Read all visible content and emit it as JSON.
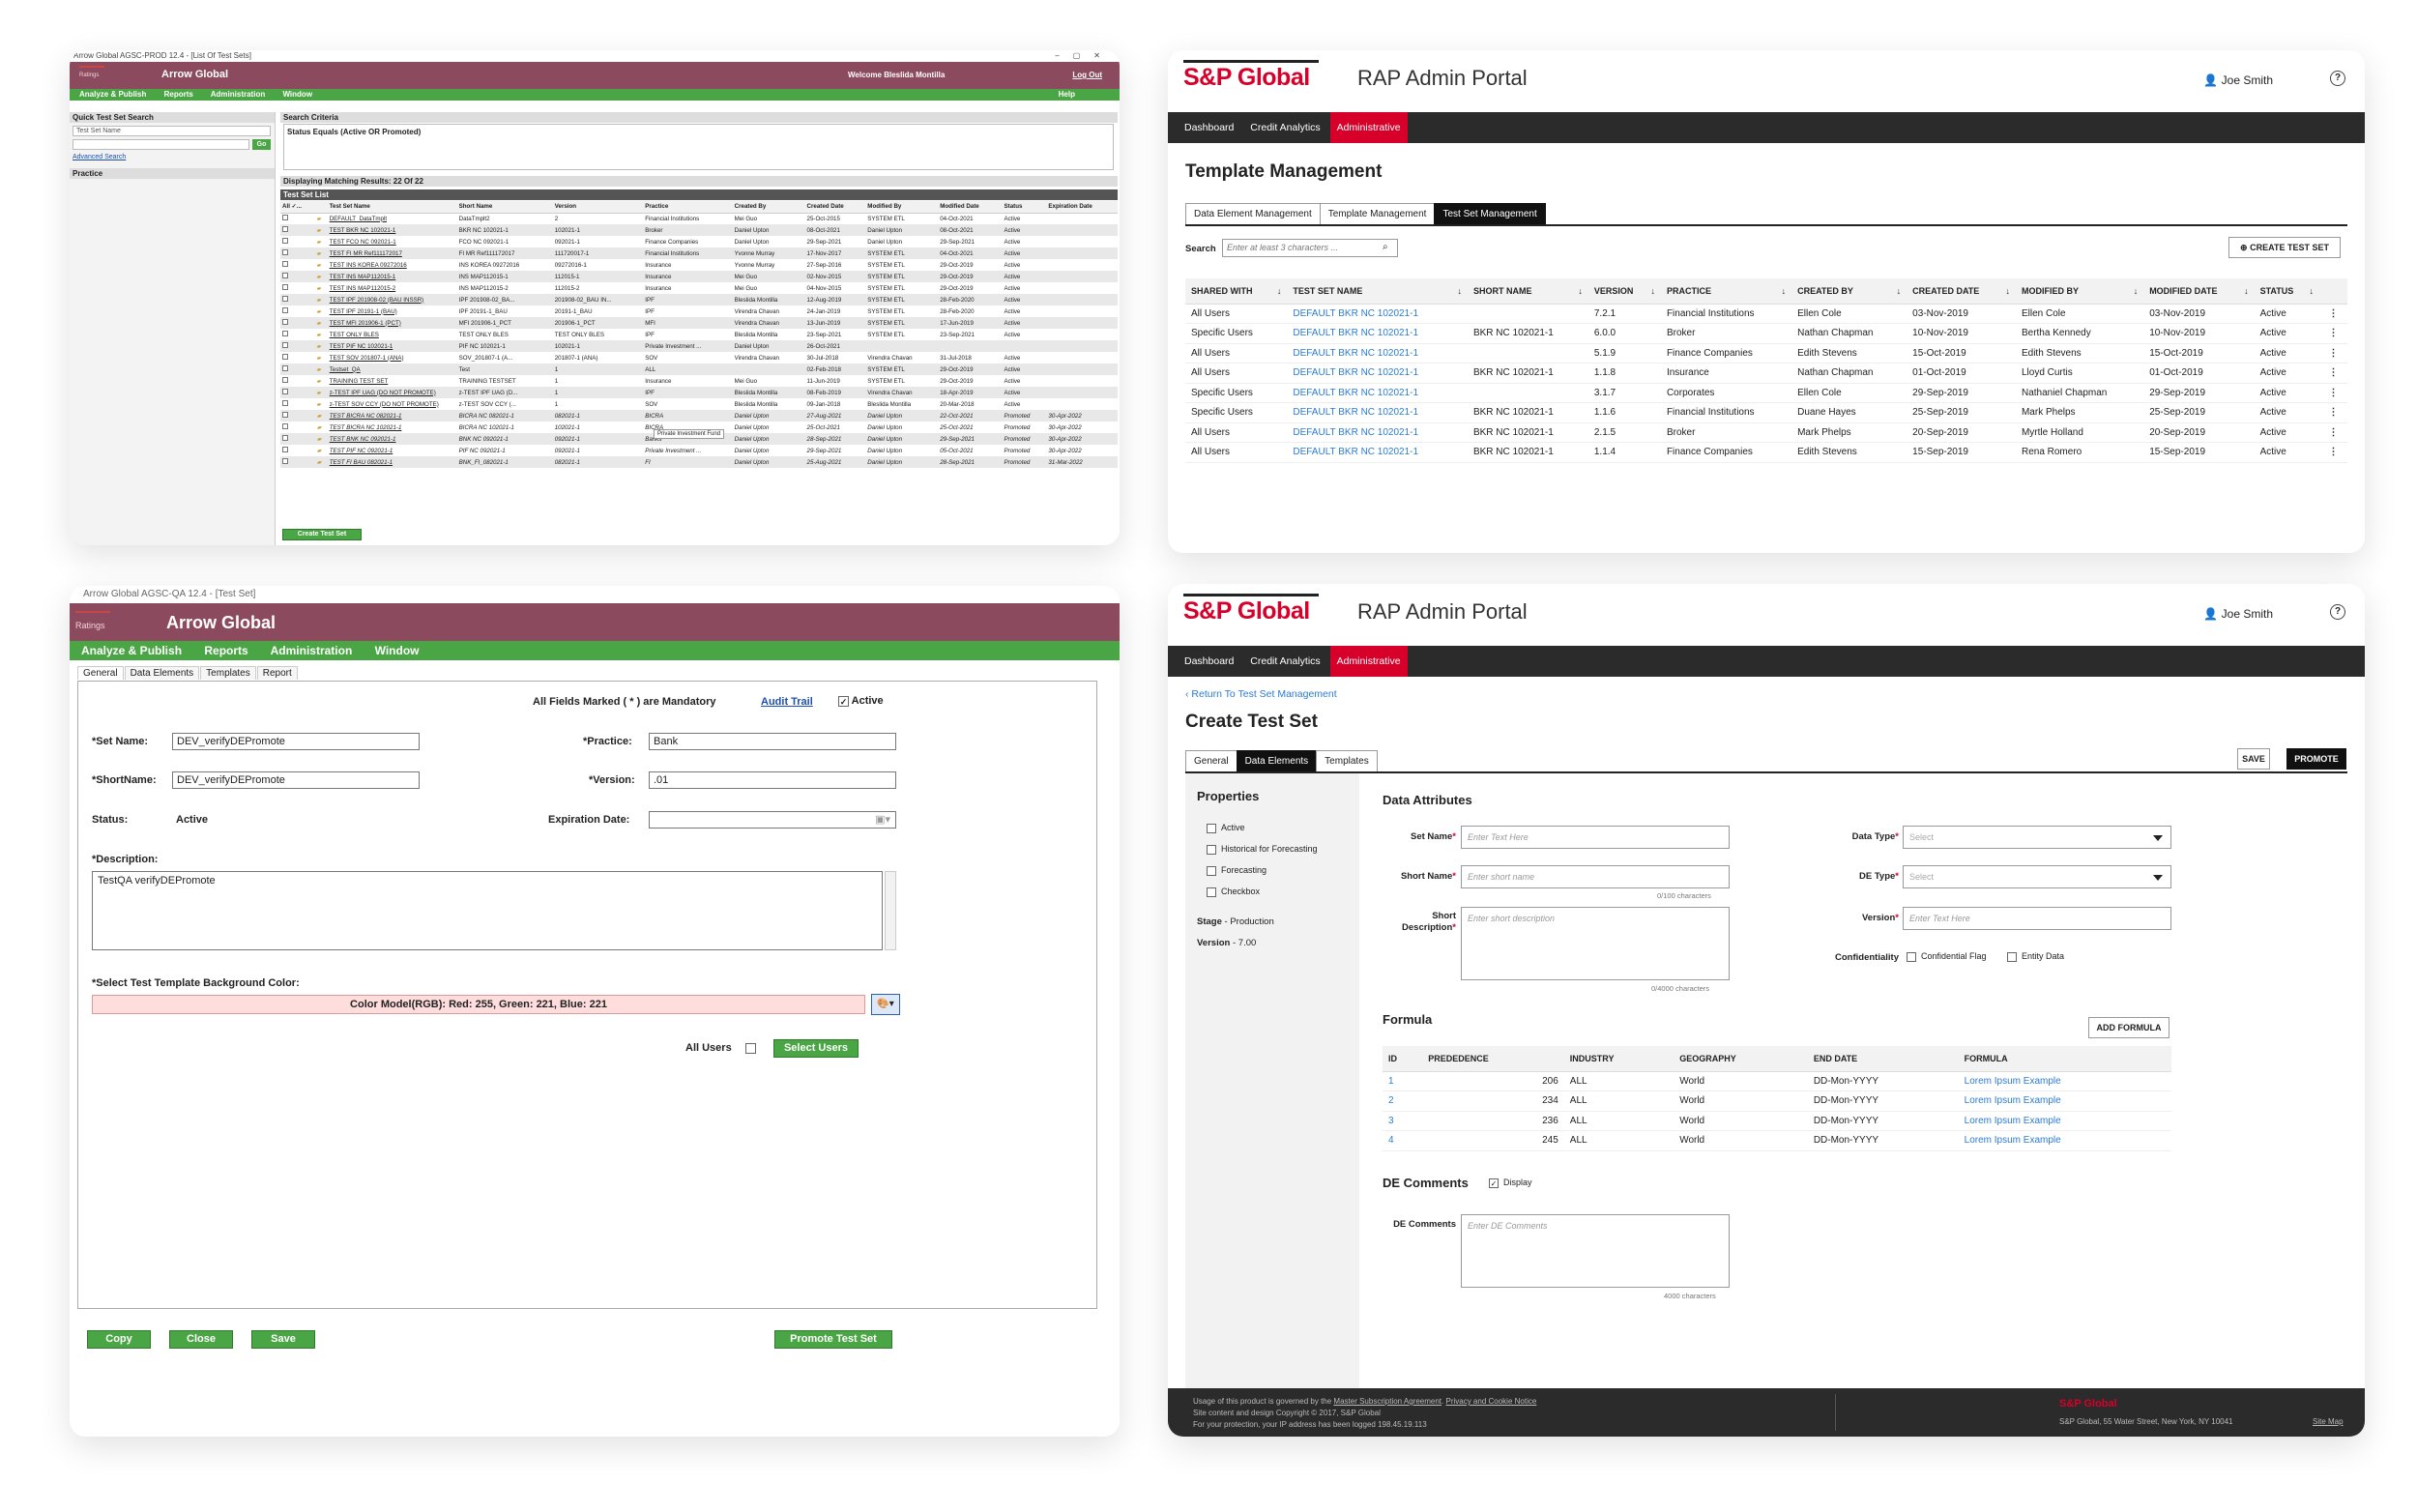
{
  "legacy_list": {
    "window_title": "Arrow Global AGSC-PROD 12.4 - [List Of Test Sets]",
    "logo_text": "Ratings",
    "app_name": "Arrow Global",
    "welcome": "Welcome  Bleslida Montilla",
    "logout": "Log Out",
    "nav": [
      "Analyze & Publish",
      "Reports",
      "Administration",
      "Window"
    ],
    "help": "Help",
    "quick_search_title": "Quick Test Set Search",
    "quick_search_select": "Test Set Name",
    "go": "Go",
    "advanced_search": "Advanced Search",
    "practice_title": "Practice",
    "search_criteria_title": "Search Criteria",
    "search_criteria_value": "Status Equals (Active OR Promoted)",
    "results": "Displaying Matching Results: 22 Of 22",
    "list_title": "Test Set List",
    "columns": [
      "All ✓...",
      "",
      "Test Set Name",
      "Short Name",
      "Version",
      "Practice",
      "Created By",
      "Created Date",
      "Modified By",
      "Modified Date",
      "Status",
      "Expiration Date"
    ],
    "rows": [
      [
        "DEFAULT_DataTmplt",
        "DataTmplt2",
        "2",
        "Financial Institutions",
        "Mei Guo",
        "25-Oct-2015",
        "SYSTEM ETL",
        "04-Oct-2021",
        "Active",
        ""
      ],
      [
        "TEST BKR NC 102021-1",
        "BKR NC 102021-1",
        "102021-1",
        "Broker",
        "Daniel Upton",
        "08-Oct-2021",
        "Daniel Upton",
        "08-Oct-2021",
        "Active",
        ""
      ],
      [
        "TEST FCO NC 092021-1",
        "FCO NC 092021-1",
        "092021-1",
        "Finance Companies",
        "Daniel Upton",
        "29-Sep-2021",
        "Daniel Upton",
        "29-Sep-2021",
        "Active",
        ""
      ],
      [
        "TEST FI MR Ref111172017",
        "FI MR Ref111172017",
        "111720017-1",
        "Financial Institutions",
        "Yvonne Murray",
        "17-Nov-2017",
        "SYSTEM ETL",
        "04-Oct-2021",
        "Active",
        ""
      ],
      [
        "TEST INS KOREA 09272016",
        "INS KOREA 09272016",
        "09272016-1",
        "Insurance",
        "Yvonne Murray",
        "27-Sep-2016",
        "SYSTEM ETL",
        "29-Oct-2019",
        "Active",
        ""
      ],
      [
        "TEST INS MAP112015-1",
        "INS MAP112015-1",
        "112015-1",
        "Insurance",
        "Mei Guo",
        "02-Nov-2015",
        "SYSTEM ETL",
        "29-Oct-2019",
        "Active",
        ""
      ],
      [
        "TEST INS MAP112015-2",
        "INS MAP112015-2",
        "112015-2",
        "Insurance",
        "Mei Guo",
        "04-Nov-2015",
        "SYSTEM ETL",
        "29-Oct-2019",
        "Active",
        ""
      ],
      [
        "TEST IPF 201908-02 (BAU INSSR)",
        "IPF 201908-02_BA...",
        "201908-02_BAU IN...",
        "IPF",
        "Bleslida Montilla",
        "12-Aug-2019",
        "SYSTEM ETL",
        "28-Feb-2020",
        "Active",
        ""
      ],
      [
        "TEST IPF 20191-1 (BAU)",
        "IPF 20191-1_BAU",
        "20191-1_BAU",
        "IPF",
        "Virendra Chavan",
        "24-Jan-2019",
        "SYSTEM ETL",
        "28-Feb-2020",
        "Active",
        ""
      ],
      [
        "TEST MFI 201906-1 (PCT)",
        "MFI 201906-1_PCT",
        "201906-1_PCT",
        "MFI",
        "Virendra Chavan",
        "13-Jun-2019",
        "SYSTEM ETL",
        "17-Jun-2019",
        "Active",
        ""
      ],
      [
        "TEST ONLY BLES",
        "TEST ONLY BLES",
        "TEST ONLY BLES",
        "IPF",
        "Bleslida Montilla",
        "23-Sep-2021",
        "SYSTEM ETL",
        "23-Sep-2021",
        "Active",
        ""
      ],
      [
        "TEST PIF NC 102021-1",
        "PIF NC 102021-1",
        "102021-1",
        "Private Investment ...",
        "Daniel Upton",
        "26-Oct-2021",
        "",
        "",
        "",
        ""
      ],
      [
        "TEST SOV 201807-1 (ANA)",
        "SOV_201807-1 (A...",
        "201807-1 (ANA)",
        "SOV",
        "Virendra Chavan",
        "30-Jul-2018",
        "Virendra Chavan",
        "31-Jul-2018",
        "Active",
        ""
      ],
      [
        "Testset_QA",
        "Test",
        "1",
        "ALL",
        "",
        "02-Feb-2018",
        "SYSTEM ETL",
        "29-Oct-2019",
        "Active",
        ""
      ],
      [
        "TRAINING TEST SET",
        "TRAINING TESTSET",
        "1",
        "Insurance",
        "Mei Guo",
        "11-Jun-2019",
        "SYSTEM ETL",
        "29-Oct-2019",
        "Active",
        ""
      ],
      [
        "z-TEST IPF UAG (DO NOT PROMOTE)",
        "z-TEST IPF UAG (D...",
        "1",
        "IPF",
        "Bleslida Montilla",
        "08-Feb-2019",
        "Virendra Chavan",
        "18-Apr-2019",
        "Active",
        ""
      ],
      [
        "z-TEST SOV CCY (DO NOT PROMOTE)",
        "z-TEST SOV CCY (...",
        "1",
        "SOV",
        "Bleslida Montilla",
        "09-Jan-2018",
        "Bleslida Montilla",
        "20-Mar-2018",
        "Active",
        ""
      ],
      [
        "TEST BICRA NC 082021-1",
        "BICRA NC 082021-1",
        "082021-1",
        "BICRA",
        "Daniel Upton",
        "27-Aug-2021",
        "Daniel Upton",
        "22-Oct-2021",
        "Promoted",
        "30-Apr-2022"
      ],
      [
        "TEST BICRA NC 102021-1",
        "BICRA NC 102021-1",
        "102021-1",
        "BICRA",
        "Daniel Upton",
        "25-Oct-2021",
        "Daniel Upton",
        "25-Oct-2021",
        "Promoted",
        "30-Apr-2022"
      ],
      [
        "TEST BNK NC 092021-1",
        "BNK NC 092021-1",
        "092021-1",
        "Banks",
        "Daniel Upton",
        "28-Sep-2021",
        "Daniel Upton",
        "29-Sep-2021",
        "Promoted",
        "30-Apr-2022"
      ],
      [
        "TEST PIF NC 092021-1",
        "PIF NC 092021-1",
        "092021-1",
        "Private Investment ...",
        "Daniel Upton",
        "29-Sep-2021",
        "Daniel Upton",
        "05-Oct-2021",
        "Promoted",
        "30-Apr-2022"
      ],
      [
        "TEST FI BAU 082021-1",
        "BNK_FI_082021-1",
        "082021-1",
        "FI",
        "Daniel Upton",
        "25-Aug-2021",
        "Daniel Upton",
        "28-Sep-2021",
        "Promoted",
        "31-Mar-2022"
      ]
    ],
    "tooltip": "Private Investment Fund",
    "create_button": "Create Test Set"
  },
  "legacy_form": {
    "window_title": "Arrow Global AGSC-QA 12.4 - [Test Set]",
    "logo_text": "Ratings",
    "app_name": "Arrow Global",
    "nav": [
      "Analyze & Publish",
      "Reports",
      "Administration",
      "Window"
    ],
    "tabs": [
      "General",
      "Data Elements",
      "Templates",
      "Report"
    ],
    "mandatory_note": "All Fields Marked ( * ) are Mandatory",
    "audit_trail": "Audit Trail",
    "active_label": "Active",
    "set_name_label": "*Set Name:",
    "set_name_value": "DEV_verifyDEPromote",
    "short_name_label": "*ShortName:",
    "short_name_value": "DEV_verifyDEPromote",
    "status_label": "Status:",
    "status_value": "Active",
    "practice_label": "*Practice:",
    "practice_value": "Bank",
    "version_label": "*Version:",
    "version_value": ".01",
    "expiration_label": "Expiration Date:",
    "description_label": "*Description:",
    "description_value": "TestQA verifyDEPromote",
    "bg_color_label": "*Select Test Template Background Color:",
    "color_model": "Color Model(RGB): Red: 255, Green: 221, Blue: 221",
    "all_users": "All Users",
    "select_users": "Select Users",
    "buttons": {
      "copy": "Copy",
      "close": "Close",
      "save": "Save",
      "promote": "Promote Test Set"
    },
    "colors": {
      "swatch": "#ffdddd"
    }
  },
  "modern_list": {
    "brand": "S&P Global",
    "portal": "RAP Admin Portal",
    "user": "Joe Smith",
    "nav": [
      "Dashboard",
      "Credit Analytics",
      "Administrative"
    ],
    "page_title": "Template Management",
    "tabs": [
      "Data Element Management",
      "Template Management",
      "Test Set Management"
    ],
    "search_label": "Search",
    "search_placeholder": "Enter at least 3 characters ...",
    "create_button": "CREATE TEST SET",
    "columns": [
      "SHARED WITH",
      "TEST SET NAME",
      "SHORT NAME",
      "VERSION",
      "PRACTICE",
      "CREATED BY",
      "CREATED DATE",
      "MODIFIED BY",
      "MODIFIED DATE",
      "STATUS"
    ],
    "rows": [
      [
        "All Users",
        "DEFAULT BKR NC 102021-1",
        "",
        "7.2.1",
        "Financial Institutions",
        "Ellen Cole",
        "03-Nov-2019",
        "Ellen Cole",
        "03-Nov-2019",
        "Active"
      ],
      [
        "Specific Users",
        "DEFAULT BKR NC 102021-1",
        "BKR NC 102021-1",
        "6.0.0",
        "Broker",
        "Nathan Chapman",
        "10-Nov-2019",
        "Bertha Kennedy",
        "10-Nov-2019",
        "Active"
      ],
      [
        "All Users",
        "DEFAULT BKR NC 102021-1",
        "",
        "5.1.9",
        "Finance Companies",
        "Edith Stevens",
        "15-Oct-2019",
        "Edith Stevens",
        "15-Oct-2019",
        "Active"
      ],
      [
        "All Users",
        "DEFAULT BKR NC 102021-1",
        "BKR NC 102021-1",
        "1.1.8",
        "Insurance",
        "Nathan Chapman",
        "01-Oct-2019",
        "Lloyd Curtis",
        "01-Oct-2019",
        "Active"
      ],
      [
        "Specific Users",
        "DEFAULT BKR NC 102021-1",
        "",
        "3.1.7",
        "Corporates",
        "Ellen Cole",
        "29-Sep-2019",
        "Nathaniel Chapman",
        "29-Sep-2019",
        "Active"
      ],
      [
        "Specific Users",
        "DEFAULT BKR NC 102021-1",
        "BKR NC 102021-1",
        "1.1.6",
        "Financial Institutions",
        "Duane Hayes",
        "25-Sep-2019",
        "Mark Phelps",
        "25-Sep-2019",
        "Active"
      ],
      [
        "All Users",
        "DEFAULT BKR NC 102021-1",
        "BKR NC 102021-1",
        "2.1.5",
        "Broker",
        "Mark Phelps",
        "20-Sep-2019",
        "Myrtle Holland",
        "20-Sep-2019",
        "Active"
      ],
      [
        "All Users",
        "DEFAULT BKR NC 102021-1",
        "BKR NC 102021-1",
        "1.1.4",
        "Finance Companies",
        "Edith Stevens",
        "15-Sep-2019",
        "Rena Romero",
        "15-Sep-2019",
        "Active"
      ]
    ],
    "colors": {
      "brand": "#d6002a",
      "link": "#2b7bd3"
    }
  },
  "modern_form": {
    "brand": "S&P Global",
    "portal": "RAP Admin Portal",
    "user": "Joe Smith",
    "nav": [
      "Dashboard",
      "Credit Analytics",
      "Administrative"
    ],
    "back_link": "Return To Test Set Management",
    "page_title": "Create Test Set",
    "tabs": [
      "General",
      "Data Elements",
      "Templates"
    ],
    "save": "SAVE",
    "promote": "PROMOTE",
    "properties_title": "Properties",
    "properties": [
      "Active",
      "Historical for Forecasting",
      "Forecasting",
      "Checkbox"
    ],
    "stage_label": "Stage",
    "stage_value": "Production",
    "version_label": "Version",
    "version_value": "7.00",
    "data_attributes_title": "Data Attributes",
    "set_name_label": "Set Name",
    "short_name_label": "Short Name",
    "short_desc_label_1": "Short",
    "short_desc_label_2": "Description",
    "text_placeholder": "Enter Text Here",
    "short_name_placeholder": "Enter short name",
    "short_desc_placeholder": "Enter short description",
    "short_name_count": "0/100 characters",
    "short_desc_count": "0/4000 characters",
    "data_type_label": "Data Type",
    "de_type_label": "DE Type",
    "version_field_label": "Version",
    "select_placeholder": "Select",
    "confidentiality_label": "Confidentiality",
    "confidential_flag": "Confidential Flag",
    "entity_data": "Entity Data",
    "formula_title": "Formula",
    "add_formula": "ADD FORMULA",
    "formula_columns": [
      "ID",
      "PREDEDENCE",
      "INDUSTRY",
      "GEOGRAPHY",
      "END DATE",
      "FORMULA"
    ],
    "formula_rows": [
      [
        "1",
        "206",
        "ALL",
        "World",
        "DD-Mon-YYYY",
        "Lorem Ipsum Example"
      ],
      [
        "2",
        "234",
        "ALL",
        "World",
        "DD-Mon-YYYY",
        "Lorem Ipsum Example"
      ],
      [
        "3",
        "236",
        "ALL",
        "World",
        "DD-Mon-YYYY",
        "Lorem Ipsum Example"
      ],
      [
        "4",
        "245",
        "ALL",
        "World",
        "DD-Mon-YYYY",
        "Lorem Ipsum Example"
      ]
    ],
    "de_comments_title": "DE Comments",
    "display_label": "Display",
    "de_comments_label": "DE Comments",
    "de_comments_placeholder": "Enter DE Comments",
    "de_comments_count": "4000 characters",
    "footer_line1_pre": "Usage of this product is governed by the ",
    "footer_link1": "Master Subscription Agreement",
    "footer_link2": "Privacy and Cookie Notice",
    "footer_line2": "Site content and design Copyright © 2017, S&P Global",
    "footer_line3": "For your protection, your IP address has been logged 198.45.19.113",
    "footer_address": "S&P Global, 55 Water Street, New York, NY 10041",
    "footer_sitemap": "Site Map"
  }
}
